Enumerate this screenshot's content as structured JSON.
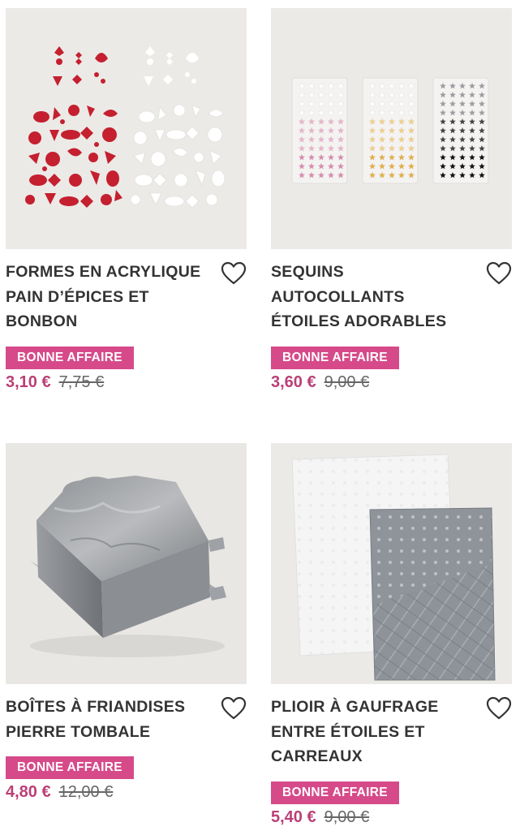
{
  "products": [
    {
      "title": "FORMES EN ACRYLIQUE PAIN D’ÉPICES ET BONBON",
      "badge": "BONNE AFFAIRE",
      "price_now": "3,10 €",
      "price_old": "7,75 €",
      "icon": "heart-outline-icon"
    },
    {
      "title": "SEQUINS AUTOCOLLANTS ÉTOILES ADORABLES",
      "badge": "BONNE AFFAIRE",
      "price_now": "3,60 €",
      "price_old": "9,00 €",
      "icon": "heart-outline-icon"
    },
    {
      "title": "BOÎTES À FRIANDISES PIERRE TOMBALE",
      "badge": "BONNE AFFAIRE",
      "price_now": "4,80 €",
      "price_old": "12,00 €",
      "icon": "heart-outline-icon"
    },
    {
      "title": "PLIOIR À GAUFRAGE ENTRE ÉTOILES ET CARREAUX",
      "badge": "BONNE AFFAIRE",
      "price_now": "5,40 €",
      "price_old": "9,00 €",
      "icon": "heart-outline-icon"
    }
  ],
  "colors": {
    "badge": "#d64a8a",
    "sale_price": "#bb3f76",
    "text": "#333333",
    "thumb_bg": "#eceae7"
  }
}
